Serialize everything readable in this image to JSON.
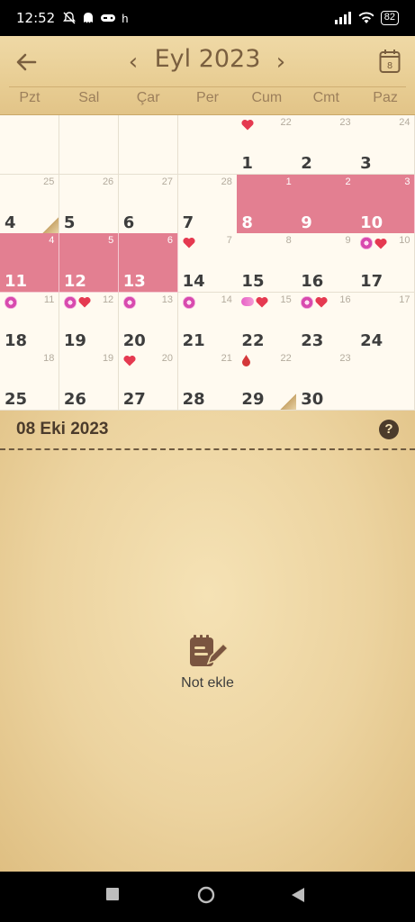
{
  "status_bar": {
    "time": "12:52",
    "left_icons": [
      "bell-muted-icon",
      "ghost-icon",
      "gamepad-icon",
      "h"
    ],
    "battery": "82"
  },
  "header": {
    "month_title": "Eyl 2023",
    "today_day": "8",
    "weekdays": [
      "Pzt",
      "Sal",
      "Çar",
      "Per",
      "Cum",
      "Cmt",
      "Paz"
    ]
  },
  "calendar": {
    "weeks": [
      [
        {
          "big": "",
          "small": ""
        },
        {
          "big": "",
          "small": ""
        },
        {
          "big": "",
          "small": ""
        },
        {
          "big": "",
          "small": ""
        },
        {
          "big": "1",
          "small": "22",
          "icons": [
            "heart"
          ]
        },
        {
          "big": "2",
          "small": "23"
        },
        {
          "big": "3",
          "small": "24"
        }
      ],
      [
        {
          "big": "4",
          "small": "25",
          "fold": true
        },
        {
          "big": "5",
          "small": "26"
        },
        {
          "big": "6",
          "small": "27"
        },
        {
          "big": "7",
          "small": "28"
        },
        {
          "big": "8",
          "small": "1",
          "period": true
        },
        {
          "big": "9",
          "small": "2",
          "period": true
        },
        {
          "big": "10",
          "small": "3",
          "period": true
        }
      ],
      [
        {
          "big": "11",
          "small": "4",
          "period": true
        },
        {
          "big": "12",
          "small": "5",
          "period": true
        },
        {
          "big": "13",
          "small": "6",
          "period": true
        },
        {
          "big": "14",
          "small": "7",
          "icons": [
            "heart"
          ]
        },
        {
          "big": "15",
          "small": "8"
        },
        {
          "big": "16",
          "small": "9"
        },
        {
          "big": "17",
          "small": "10",
          "icons": [
            "flower",
            "heart"
          ]
        }
      ],
      [
        {
          "big": "18",
          "small": "11",
          "icons": [
            "flower"
          ]
        },
        {
          "big": "19",
          "small": "12",
          "icons": [
            "flower",
            "heart"
          ]
        },
        {
          "big": "20",
          "small": "13",
          "icons": [
            "flower"
          ]
        },
        {
          "big": "21",
          "small": "14",
          "icons": [
            "flower"
          ]
        },
        {
          "big": "22",
          "small": "15",
          "icons": [
            "pill",
            "heart"
          ]
        },
        {
          "big": "23",
          "small": "16",
          "icons": [
            "flower",
            "heart"
          ]
        },
        {
          "big": "24",
          "small": "17"
        }
      ],
      [
        {
          "big": "25",
          "small": "18"
        },
        {
          "big": "26",
          "small": "19"
        },
        {
          "big": "27",
          "small": "20",
          "icons": [
            "heart"
          ]
        },
        {
          "big": "28",
          "small": "21"
        },
        {
          "big": "29",
          "small": "22",
          "icons": [
            "drop"
          ],
          "fold": true
        },
        {
          "big": "30",
          "small": "23"
        },
        {
          "big": "",
          "small": ""
        }
      ]
    ]
  },
  "notes": {
    "selected_date": "08 Eki 2023",
    "add_note_label": "Not ekle"
  },
  "colors": {
    "period": "#e37f91",
    "header_text": "#7a5f3f",
    "accent_brown": "#4b3b2b"
  }
}
